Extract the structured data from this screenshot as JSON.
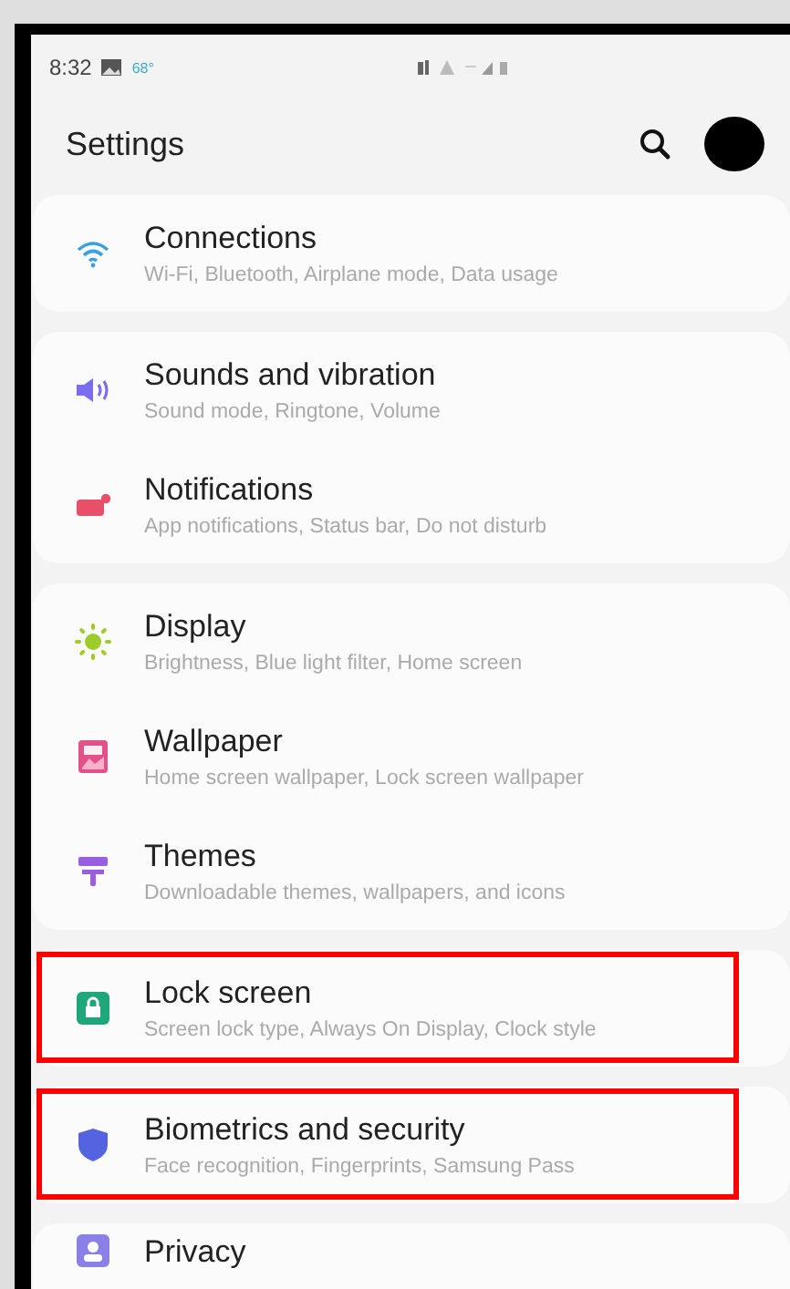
{
  "status_bar": {
    "time": "8:32",
    "temperature": "68°"
  },
  "header": {
    "title": "Settings"
  },
  "groups": [
    {
      "items": [
        {
          "kind": "wifi",
          "title": "Connections",
          "subtitle": "Wi-Fi, Bluetooth, Airplane mode, Data usage",
          "highlighted": false
        }
      ]
    },
    {
      "items": [
        {
          "kind": "sound",
          "title": "Sounds and vibration",
          "subtitle": "Sound mode, Ringtone, Volume",
          "highlighted": false
        },
        {
          "kind": "notifications",
          "title": "Notifications",
          "subtitle": "App notifications, Status bar, Do not disturb",
          "highlighted": false
        }
      ]
    },
    {
      "items": [
        {
          "kind": "display",
          "title": "Display",
          "subtitle": "Brightness, Blue light filter, Home screen",
          "highlighted": false
        },
        {
          "kind": "wallpaper",
          "title": "Wallpaper",
          "subtitle": "Home screen wallpaper, Lock screen wallpaper",
          "highlighted": false
        },
        {
          "kind": "themes",
          "title": "Themes",
          "subtitle": "Downloadable themes, wallpapers, and icons",
          "highlighted": false
        }
      ]
    },
    {
      "items": [
        {
          "kind": "lock",
          "title": "Lock screen",
          "subtitle": "Screen lock type, Always On Display, Clock style",
          "highlighted": true
        }
      ]
    },
    {
      "items": [
        {
          "kind": "shield",
          "title": "Biometrics and security",
          "subtitle": "Face recognition, Fingerprints, Samsung Pass",
          "highlighted": true
        }
      ]
    },
    {
      "items": [
        {
          "kind": "privacy",
          "title": "Privacy",
          "highlighted": false
        }
      ]
    }
  ]
}
